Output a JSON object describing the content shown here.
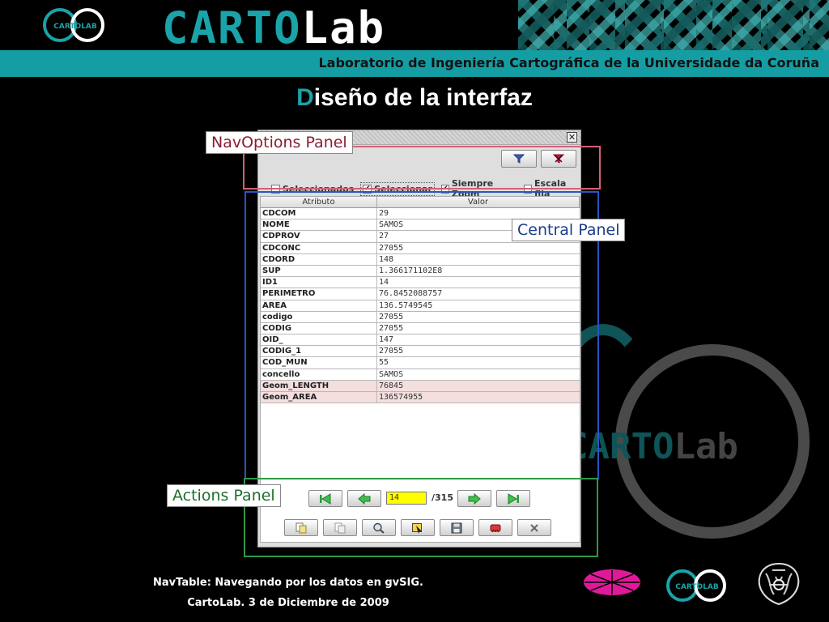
{
  "header": {
    "logo_text": "CARTOLAB",
    "wordmark_part1": "CARTO",
    "wordmark_part2": "Lab",
    "bar_caption": "Laboratorio de Ingeniería Cartográfica de la Universidade da Coruña",
    "colors": {
      "teal": "#149ea3",
      "background": "#000000"
    }
  },
  "slide": {
    "title_first_letter": "D",
    "title_rest": "iseño de la interfaz"
  },
  "annotations": {
    "nav_options": "NavOptions Panel",
    "central": "Central Panel",
    "actions": "Actions Panel"
  },
  "window": {
    "toolbar": [
      {
        "icon": "filter-icon"
      },
      {
        "icon": "filter-remove-icon"
      }
    ],
    "checkboxes": [
      {
        "label": "Seleccionados",
        "checked": false
      },
      {
        "label": "Seleccionar",
        "checked": true
      },
      {
        "label": "Siempre Zoom",
        "checked": true
      },
      {
        "label": "Escala fija",
        "checked": false
      }
    ],
    "table": {
      "headers": [
        "Atributo",
        "Valor"
      ],
      "rows": [
        [
          "CDCOM",
          "29"
        ],
        [
          "NOME",
          "SAMOS"
        ],
        [
          "CDPROV",
          "27"
        ],
        [
          "CDCONC",
          "27055"
        ],
        [
          "CDORD",
          "148"
        ],
        [
          "SUP",
          "1.366171102E8"
        ],
        [
          "ID1",
          "14"
        ],
        [
          "PERIMETRO",
          "76.8452088757"
        ],
        [
          "AREA",
          "136.5749545"
        ],
        [
          "codigo",
          "27055"
        ],
        [
          "CODIG",
          "27055"
        ],
        [
          "OID_",
          "147"
        ],
        [
          "CODIG_1",
          "27055"
        ],
        [
          "COD_MUN",
          "55"
        ],
        [
          "concello",
          "SAMOS"
        ],
        [
          "Geom_LENGTH",
          "76845"
        ],
        [
          "Geom_AREA",
          "136574955"
        ]
      ]
    },
    "navigation": {
      "current": "14",
      "total": "/315"
    },
    "actions": [
      {
        "icon": "copy-selected-icon"
      },
      {
        "icon": "copy-previous-icon"
      },
      {
        "icon": "zoom-icon"
      },
      {
        "icon": "select-icon"
      },
      {
        "icon": "save-icon"
      },
      {
        "icon": "delete-record-icon"
      },
      {
        "icon": "close-icon"
      }
    ]
  },
  "footer": {
    "line1": "NavTable: Navegando por los datos en gvSIG.",
    "line2": "CartoLab. 3 de Diciembre de 2009",
    "logo_text": "CARTOLAB"
  }
}
